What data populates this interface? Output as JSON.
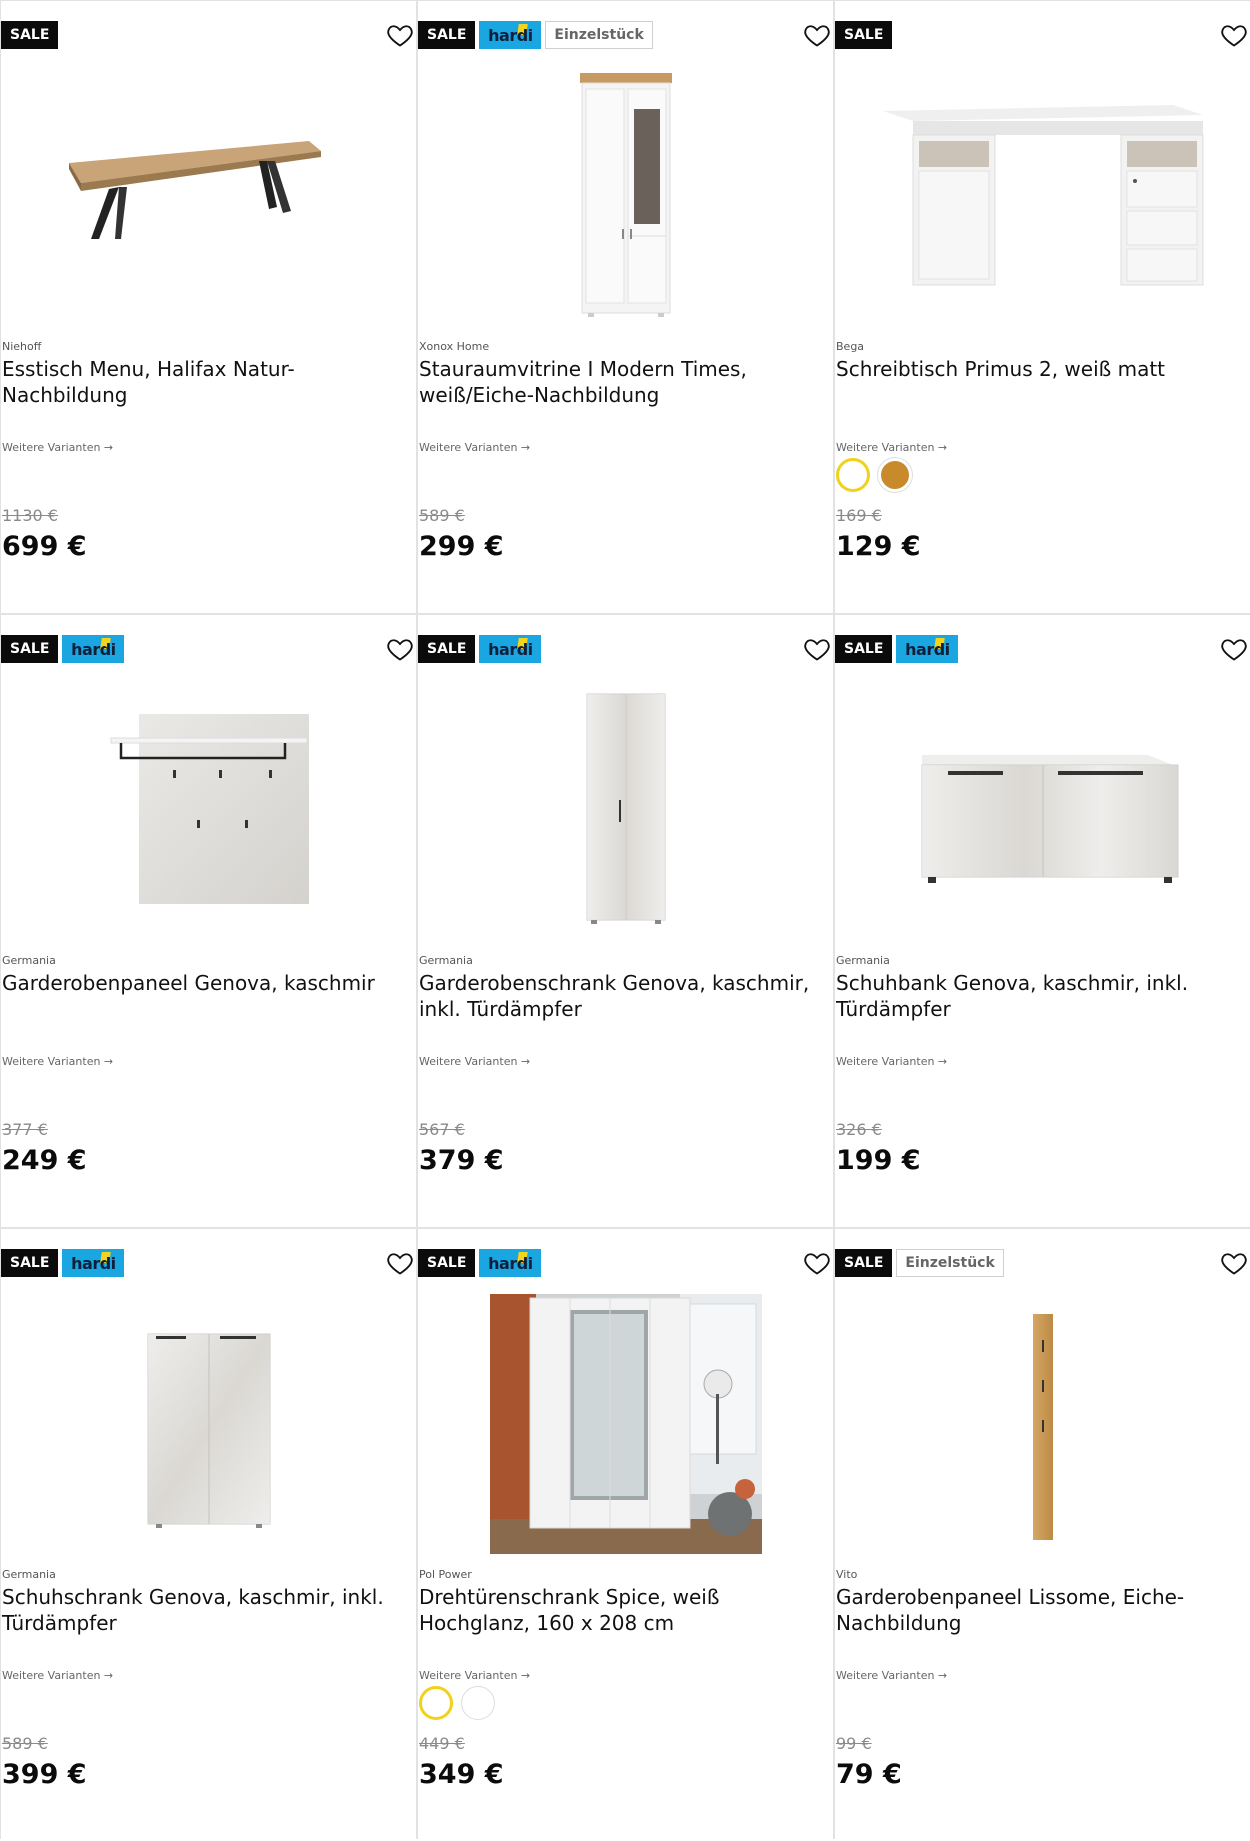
{
  "colors": {
    "sale_bg": "#0b0b0b",
    "hardi_bg": "#1aa6e0",
    "hardi_accent": "#f3d31b",
    "swatch_selected": "#f0d21a",
    "swatch_oak": "#c98a2c"
  },
  "products": [
    {
      "badges": {
        "sale": "SALE"
      },
      "brand": "Niehoff",
      "title": "Esstisch Menu, Halifax Natur-Nachbildung",
      "variants": "Weitere Varianten →",
      "old_price": "1130 €",
      "price": "699 €",
      "image": "table-image"
    },
    {
      "badges": {
        "sale": "SALE",
        "hardi": "hardi",
        "einzel": "Einzelstück"
      },
      "brand": "Xonox Home",
      "title": "Stauraumvitrine I Modern Times, weiß/Eiche-Nachbildung",
      "variants": "Weitere Varianten →",
      "old_price": "589 €",
      "price": "299 €",
      "image": "vitrine-image"
    },
    {
      "badges": {
        "sale": "SALE"
      },
      "brand": "Bega",
      "title": "Schreibtisch Primus 2, weiß matt",
      "variants": "Weitere Varianten →",
      "old_price": "169 €",
      "price": "129 €",
      "image": "desk-image",
      "swatches": [
        "white",
        "oak"
      ]
    },
    {
      "badges": {
        "sale": "SALE",
        "hardi": "hardi"
      },
      "brand": "Germania",
      "title": "Garderobenpaneel Genova, kaschmir",
      "variants": "Weitere Varianten →",
      "old_price": "377 €",
      "price": "249 €",
      "image": "wall-panel-image"
    },
    {
      "badges": {
        "sale": "SALE",
        "hardi": "hardi"
      },
      "brand": "Germania",
      "title": "Garderobenschrank Genova, kaschmir, inkl. Türdämpfer",
      "variants": "Weitere Varianten →",
      "old_price": "567 €",
      "price": "379 €",
      "image": "tall-cabinet-image"
    },
    {
      "badges": {
        "sale": "SALE",
        "hardi": "hardi"
      },
      "brand": "Germania",
      "title": "Schuhbank Genova, kaschmir, inkl. Türdämpfer",
      "variants": "Weitere Varianten →",
      "old_price": "326 €",
      "price": "199 €",
      "image": "shoe-bench-image"
    },
    {
      "badges": {
        "sale": "SALE",
        "hardi": "hardi"
      },
      "brand": "Germania",
      "title": "Schuhschrank Genova, kaschmir, inkl. Türdämpfer",
      "variants": "Weitere Varianten →",
      "old_price": "589 €",
      "price": "399 €",
      "image": "shoe-cabinet-image"
    },
    {
      "badges": {
        "sale": "SALE",
        "hardi": "hardi"
      },
      "brand": "Pol Power",
      "title": "Drehtürenschrank Spice, weiß Hochglanz, 160 x 208 cm",
      "variants": "Weitere Varianten →",
      "old_price": "449 €",
      "price": "349 €",
      "image": "wardrobe-image",
      "swatches": [
        "white-selected",
        "white"
      ]
    },
    {
      "badges": {
        "sale": "SALE",
        "einzel": "Einzelstück"
      },
      "brand": "Vito",
      "title": "Garderobenpaneel Lissome, Eiche-Nachbildung",
      "variants": "Weitere Varianten →",
      "old_price": "99 €",
      "price": "79 €",
      "image": "oak-panel-image"
    }
  ]
}
